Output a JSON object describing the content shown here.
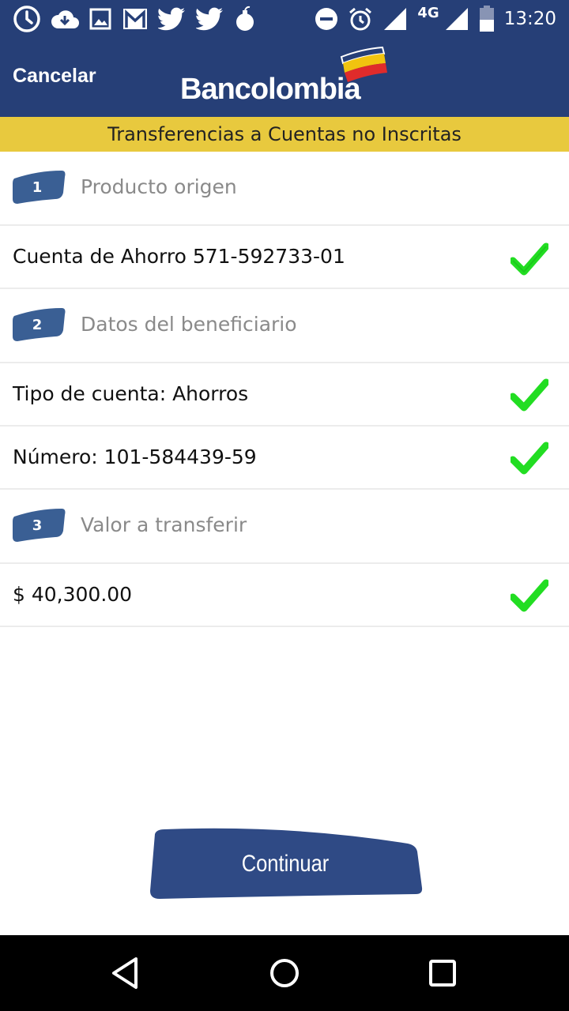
{
  "status_bar": {
    "network": "4G",
    "time": "13:20",
    "icons_left": [
      "clock-icon",
      "cloud-download-icon",
      "image-icon",
      "gmail-icon",
      "twitter-icon",
      "twitter-icon",
      "bomb-icon"
    ],
    "icons_right": [
      "dnd-icon",
      "alarm-icon",
      "signal-icon",
      "signal-icon",
      "battery-icon"
    ]
  },
  "header": {
    "cancel_label": "Cancelar",
    "logo_text": "Bancolombia",
    "colors": {
      "bar": "#263f77",
      "subtitle_bg": "#e8c93e"
    }
  },
  "subtitle": "Transferencias a Cuentas no Inscritas",
  "steps": [
    {
      "number": "1",
      "label": "Producto origen"
    },
    {
      "number": "2",
      "label": "Datos del beneficiario"
    },
    {
      "number": "3",
      "label": "Valor a transferir"
    }
  ],
  "items": {
    "origin_account": "Cuenta de Ahorro 571-592733-01",
    "account_type": "Tipo de cuenta: Ahorros",
    "account_number": "Número: 101-584439-59",
    "amount": "$ 40,300.00"
  },
  "continue_label": "Continuar",
  "nav": [
    "back-icon",
    "home-icon",
    "recents-icon"
  ]
}
